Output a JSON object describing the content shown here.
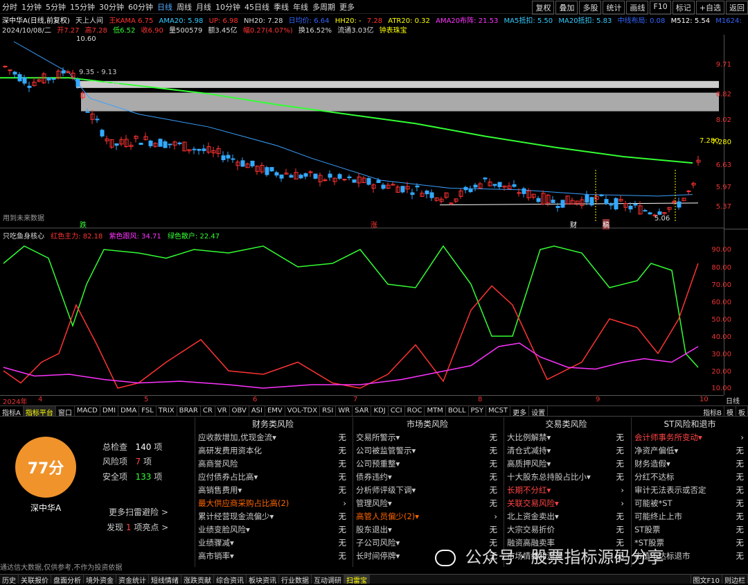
{
  "toolbar": {
    "periods": [
      "分时",
      "1分钟",
      "5分钟",
      "15分钟",
      "30分钟",
      "60分钟",
      "日线",
      "周线",
      "月线",
      "10分钟",
      "45日线",
      "季线",
      "年线",
      "多周期",
      "更多"
    ],
    "active": "日线",
    "right": [
      "复权",
      "叠加",
      "多股",
      "统计",
      "画线",
      "F10",
      "标记",
      "+自选",
      "返回"
    ]
  },
  "info1": {
    "name": "深中华A(日线,前复权)",
    "ind": "天上人间",
    "kama": "王KAMA 6.75",
    "ama": "AMA20: 5.98",
    "up": "UP: 6.98",
    "nh": "NH20: 7.28",
    "vip": "日均价: 6.64",
    "hh": "HH20: -",
    "red1": "7.28",
    "atr": "ATR20: 0.32",
    "ama20": "AMA20布阵: 21.53",
    "ma5": "MA5抵扣: 5.50",
    "ma20": "MA20抵扣: 5.83",
    "amx": "中线布局: 0.08",
    "m512": "M512: 5.54",
    "m1624": "M1624:"
  },
  "info2": {
    "date": "2024/10/08/二",
    "open": "开7.27",
    "high": "高7.28",
    "low": "低6.52",
    "close": "收6.90",
    "vol": "量500579",
    "amt": "额3.45亿",
    "chg": "幅0.27(4.07%)",
    "turn": "换16.52%",
    "flow": "流通3.03亿",
    "tag": "钟表珠宝"
  },
  "chart": {
    "y_ticks": [
      "9.71",
      "8.82",
      "8.02",
      "7.280",
      "6.63",
      "5.97",
      "5.37"
    ],
    "peak": "10.60",
    "low": "5.06",
    "band1": "9.35 - 9.13",
    "band2": "8.98 - 8.39",
    "note": "用到未来数据",
    "marks": [
      "跌",
      "涨",
      "财",
      "稿"
    ]
  },
  "osc": {
    "name": "只吃鱼身核心",
    "red": "红色主力: 82.18",
    "pur": "紫色跟风: 34.71",
    "grn": "绿色散户: 22.47",
    "ticks": [
      "90.00",
      "80.00",
      "70.00",
      "60.00",
      "50.00",
      "40.00",
      "30.00",
      "20.00",
      "10.00"
    ]
  },
  "dates": [
    "2024年",
    "4",
    "5",
    "6",
    "7",
    "8",
    "9",
    "10"
  ],
  "dateunit": "日线",
  "tabs": [
    "指标A",
    "指标平台",
    "窗口",
    "MACD",
    "DMI",
    "DMA",
    "FSL",
    "TRIX",
    "BRAR",
    "CR",
    "VR",
    "OBV",
    "ASI",
    "EMV",
    "VOL-TDX",
    "RSI",
    "WR",
    "SAR",
    "KDJ",
    "CCI",
    "ROC",
    "MTM",
    "BOLL",
    "PSY",
    "MCST",
    "更多",
    "设置"
  ],
  "tabs_right": [
    "指标B",
    "模",
    "板"
  ],
  "score": {
    "value": "77分",
    "stock": "深中华A",
    "total_l": "总检查",
    "total": "140",
    "risk_l": "风险项",
    "risk": "7",
    "safe_l": "安全项",
    "safe": "133",
    "unit": "项",
    "more": "更多扫雷避险 >",
    "find": "发现",
    "find_n": "1",
    "find_t": "项亮点 >",
    "disclaimer": "通达信大数据,仅供参考,不作为投资依据"
  },
  "cols": [
    {
      "title": "财务类风险",
      "items": [
        [
          "应收款增加,优现金流▾",
          "无",
          ""
        ],
        [
          "高研发费用资本化",
          "无",
          ""
        ],
        [
          "高商誉风险",
          "无",
          ""
        ],
        [
          "应付债券占比高▾",
          "无",
          ""
        ],
        [
          "高销售费用▾",
          "无",
          ""
        ],
        [
          "最大供应商采购占比高(2)",
          "›",
          "orange"
        ],
        [
          "累计经营现金流偏少▾",
          "无",
          ""
        ],
        [
          "业绩变脸风险▾",
          "无",
          ""
        ],
        [
          "业绩骤减▾",
          "无",
          ""
        ],
        [
          "高市销率▾",
          "无",
          ""
        ]
      ]
    },
    {
      "title": "市场类风险",
      "items": [
        [
          "交易所警示▾",
          "无",
          ""
        ],
        [
          "公司被监管警示▾",
          "无",
          ""
        ],
        [
          "公司预重整▾",
          "无",
          ""
        ],
        [
          "债券违约▾",
          "无",
          ""
        ],
        [
          "分析师评级下调▾",
          "无",
          ""
        ],
        [
          "管理风险▾",
          "无",
          ""
        ],
        [
          "高管人员偏少(2)▾",
          "›",
          "orange"
        ],
        [
          "股东退出▾",
          "无",
          ""
        ],
        [
          "子公司风险▾",
          "无",
          ""
        ],
        [
          "长时间停牌▾",
          "无",
          ""
        ]
      ]
    },
    {
      "title": "交易类风险",
      "items": [
        [
          "大比例解禁▾",
          "无",
          ""
        ],
        [
          "清仓式减持▾",
          "无",
          ""
        ],
        [
          "高质押风险▾",
          "无",
          ""
        ],
        [
          "十大股东总持股占比小▾",
          "无",
          ""
        ],
        [
          "长期不分红▾",
          "›",
          "red"
        ],
        [
          "关联交易风险▾",
          "›",
          "red"
        ],
        [
          "北上资金卖出▾",
          "无",
          ""
        ],
        [
          "大宗交易折价",
          "无",
          ""
        ],
        [
          "融资高融卖率",
          "无",
          ""
        ],
        [
          "市场情绪和流通",
          "无",
          ""
        ]
      ]
    },
    {
      "title": "ST风险和退市",
      "items": [
        [
          "会计师事务所变动▾",
          "›",
          "red"
        ],
        [
          "净资产偏低▾",
          "无",
          ""
        ],
        [
          "财务造假▾",
          "无",
          ""
        ],
        [
          "分红不达标",
          "无",
          ""
        ],
        [
          "审计无法表示或否定",
          "无",
          ""
        ],
        [
          "可能被*ST",
          "无",
          ""
        ],
        [
          "可能终止上市",
          "无",
          ""
        ],
        [
          "ST股票",
          "无",
          ""
        ],
        [
          "*ST股票",
          "无",
          ""
        ],
        [
          "市值不达标退市",
          "无",
          ""
        ]
      ]
    }
  ],
  "watermark": "公众号 · 股票指标源码分享",
  "status": [
    "历史",
    "关联报价",
    "盘面分析",
    "境外资金",
    "资金统计",
    "短线情绪",
    "涨跌贡献",
    "综合资讯",
    "板块资讯",
    "行业数据",
    "互动调研",
    "扫雷宝"
  ],
  "status_right": [
    "图文F10",
    "则边栏"
  ]
}
